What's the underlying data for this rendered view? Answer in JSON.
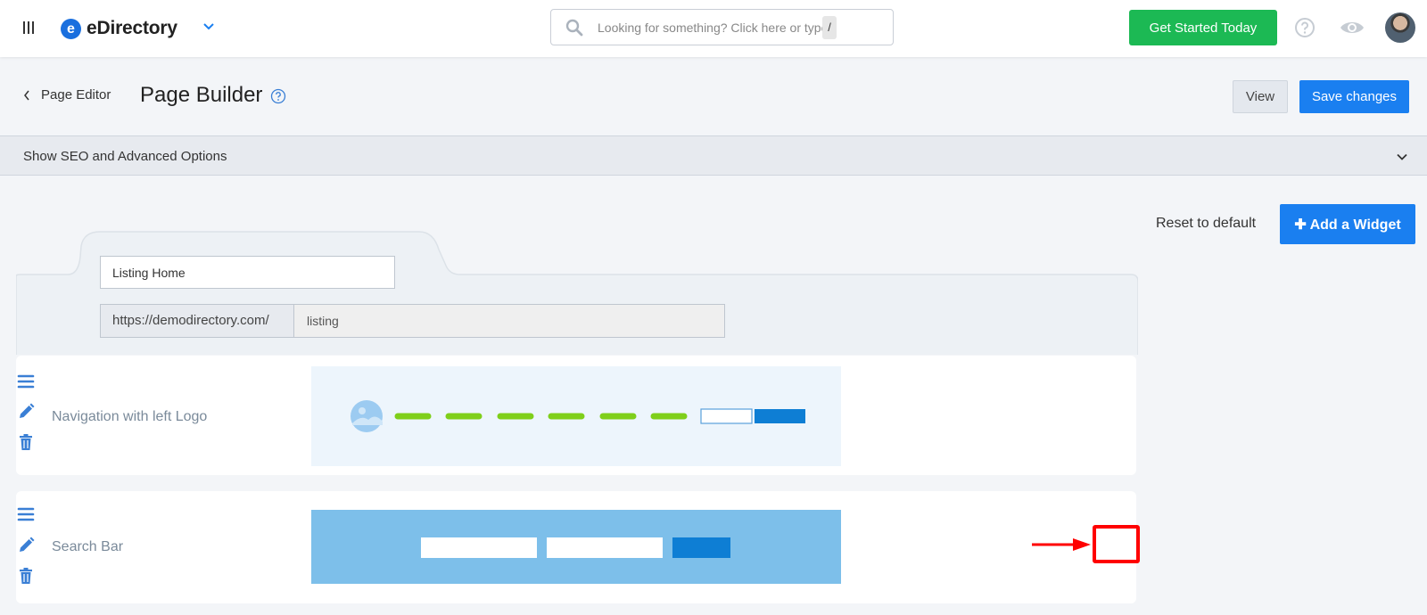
{
  "topbar": {
    "brand_logo_letter": "e",
    "brand_name": "eDirectory",
    "search_placeholder": "Looking for something? Click here or type",
    "search_shortcut": "/",
    "cta_label": "Get Started Today"
  },
  "header": {
    "back_label": "Page Editor",
    "title": "Page Builder",
    "view_label": "View",
    "save_label": "Save changes"
  },
  "seo": {
    "label": "Show SEO and Advanced Options"
  },
  "actions": {
    "reset_label": "Reset to default",
    "add_widget_label": "Add a Widget",
    "add_widget_prefix": "✚"
  },
  "page_form": {
    "page_name": "Listing Home",
    "url_prefix": "https://demodirectory.com/",
    "url_slug": "listing"
  },
  "widgets": [
    {
      "name": "Navigation with left Logo"
    },
    {
      "name": "Search Bar"
    }
  ],
  "colors": {
    "primary": "#1a7ff0",
    "cta": "#1cb954",
    "nav_dash": "#7fcf1a",
    "highlight": "#ff0000",
    "icon_blue": "#3a7fd5"
  }
}
